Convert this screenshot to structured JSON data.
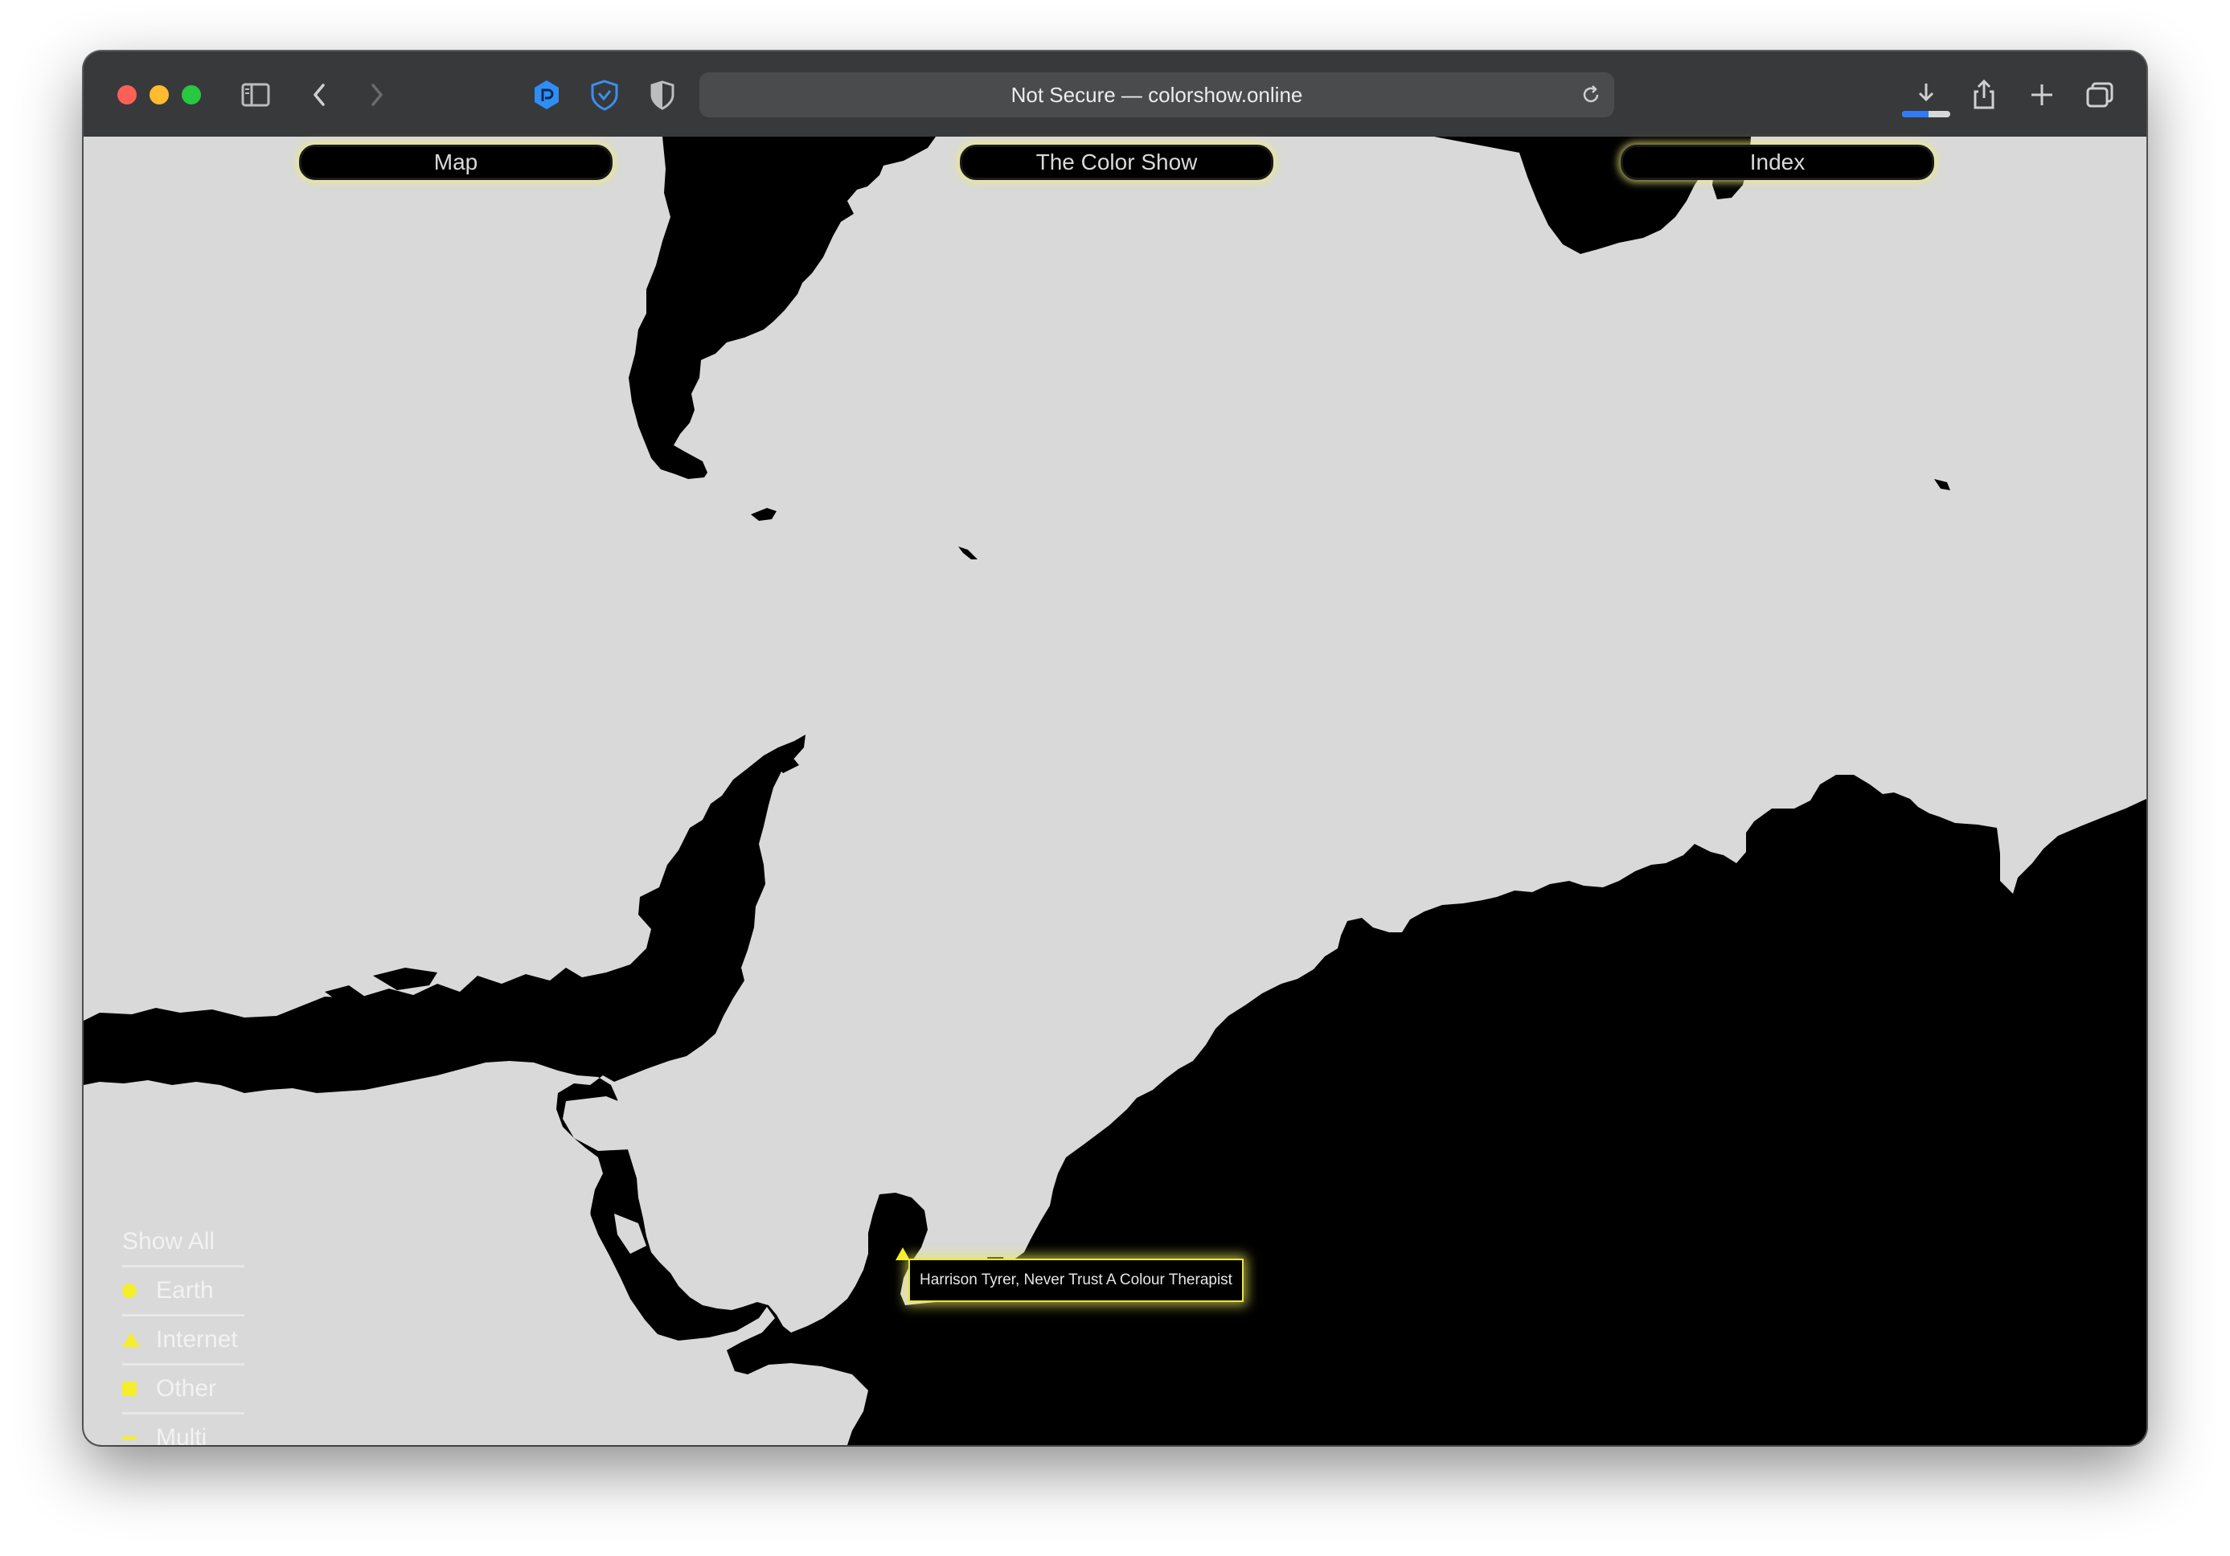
{
  "browser": {
    "address_text": "Not Secure — colorshow.online",
    "download_progress": 0.55
  },
  "nav": {
    "map": "Map",
    "show": "The Color Show",
    "index": "Index"
  },
  "legend": {
    "show_all": "Show All",
    "items": [
      {
        "label": "Earth",
        "icon": "circle-icon"
      },
      {
        "label": "Internet",
        "icon": "triangle-icon"
      },
      {
        "label": "Other",
        "icon": "square-icon"
      },
      {
        "label": "Multi",
        "icon": "dash-icon"
      }
    ]
  },
  "tooltip": {
    "text": "Harrison Tyrer, Never Trust A Colour Therapist"
  },
  "colors": {
    "land": "#000000",
    "sea": "#d9d9d9",
    "accent": "#f5ee2b",
    "toolbar": "#38393b"
  }
}
